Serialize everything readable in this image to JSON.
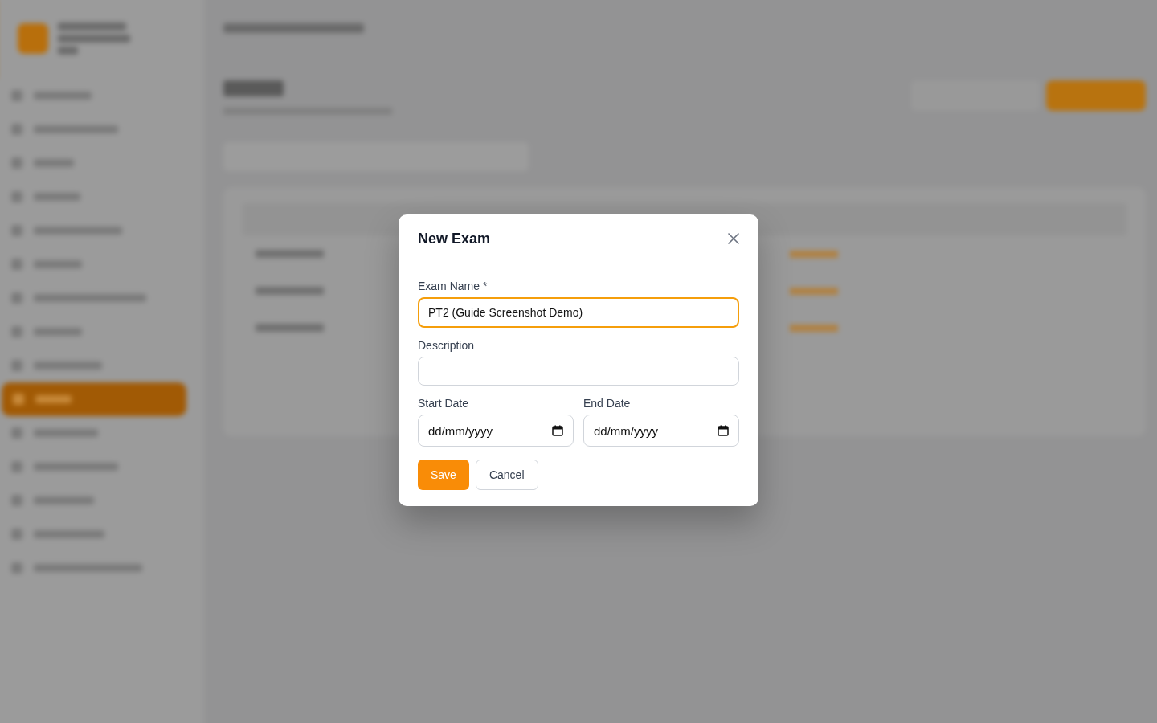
{
  "dialog": {
    "title": "New Exam",
    "fields": [
      {
        "label": "Exam Name *",
        "value": "PT2 (Guide Screenshot Demo)",
        "focused": true
      },
      {
        "label": "Description",
        "focused": false
      }
    ],
    "date_fields": [
      {
        "label": "Start Date",
        "placeholder": "dd/mm/yyyy"
      },
      {
        "label": "End Date",
        "placeholder": "dd/mm/yyyy"
      }
    ],
    "buttons": [
      {
        "kind": "primary",
        "label": "Save"
      },
      {
        "kind": "secondary",
        "label": "Cancel"
      }
    ]
  }
}
